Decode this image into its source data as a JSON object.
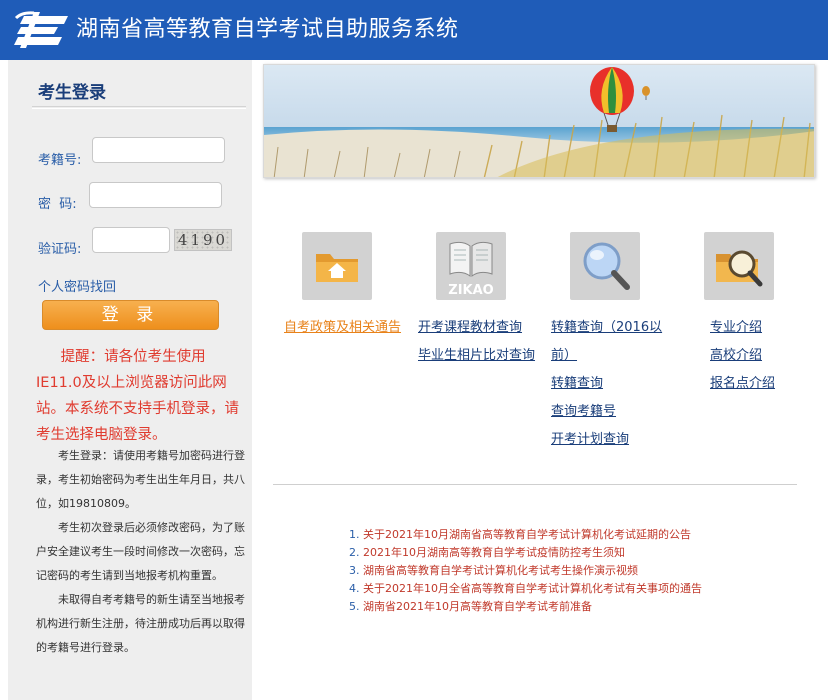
{
  "header": {
    "title": "湖南省高等教育自学考试自助服务系统"
  },
  "login": {
    "section_title": "考生登录",
    "exam_id_label": "考籍号:",
    "password_label": "密  码:",
    "captcha_label": "验证码:",
    "captcha_text": "4190",
    "forgot_link": "个人密码找回",
    "login_button": "登 录"
  },
  "warning": "提醒：请各位考生使用IE11.0及以上浏览器访问此网站。本系统不支持手机登录，请考生选择电脑登录。",
  "notes": [
    "考生登录：请使用考籍号加密码进行登录，考生初始密码为考生出生年月日，共八位，如19810809。",
    "考生初次登录后必须修改密码，为了账户安全建议考生一段时间修改一次密码，忘记密码的考生请到当地报考机构重置。",
    "未取得自考考籍号的新生请至当地报考机构进行新生注册，待注册成功后再以取得的考籍号进行登录。"
  ],
  "icons": {
    "zikao_text": "ZIKAO"
  },
  "menu": {
    "col1": [
      "自考政策及相关通告"
    ],
    "col2": [
      "开考课程教材查询",
      "毕业生相片比对查询"
    ],
    "col3": [
      "转籍查询（2016以",
      "前）",
      "转籍查询",
      "查询考籍号",
      "开考计划查询"
    ],
    "col4": [
      "专业介绍",
      "高校介绍",
      "报名点介绍"
    ]
  },
  "news": [
    {
      "num": "1.",
      "text": "关于2021年10月湖南省高等教育自学考试计算机化考试延期的公告"
    },
    {
      "num": "2.",
      "text": "2021年10月湖南高等教育自学考试疫情防控考生须知"
    },
    {
      "num": "3.",
      "text": "湖南省高等教育自学考试计算机化考试考生操作演示视频"
    },
    {
      "num": "4.",
      "text": "关于2021年10月全省高等教育自学考试计算机化考试有关事项的通告"
    },
    {
      "num": "5.",
      "text": "湖南省2021年10月高等教育自学考试考前准备"
    }
  ],
  "colors": {
    "header_blue": "#1f5cb8",
    "link_blue": "#1a3e7a",
    "accent_orange": "#ee8f1c",
    "warning_red": "#e03b2f"
  }
}
